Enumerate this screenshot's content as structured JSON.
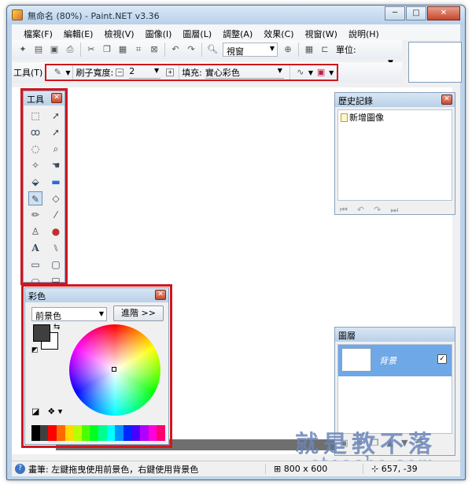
{
  "window": {
    "title": "無命名 (80%) - Paint.NET v3.36",
    "min": "─",
    "max": "□",
    "close": "✕"
  },
  "menu": [
    "檔案(F)",
    "編輯(E)",
    "檢視(V)",
    "圖像(I)",
    "圖層(L)",
    "調整(A)",
    "效果(C)",
    "視窗(W)",
    "說明(H)"
  ],
  "toolbar": {
    "zoom_value": "視窗",
    "units_label": "單位:"
  },
  "toolbar2": {
    "tool_label": "工具(T)",
    "brush_width_label": "刷子寬度:",
    "brush_width_value": "2",
    "fill_label": "填充:",
    "fill_value": "實心彩色"
  },
  "tools_panel": {
    "title": "工具"
  },
  "history_panel": {
    "title": "歷史記錄",
    "items": [
      "新增圖像"
    ]
  },
  "colors_panel": {
    "title": "彩色",
    "dropdown_value": "前景色",
    "more_button": "進階 >>",
    "primary_color": "#3f3f3f",
    "secondary_color": "#ffffff",
    "palette_colors": [
      "#000000",
      "#404040",
      "#ff0000",
      "#ff6a00",
      "#ffd800",
      "#b6ff00",
      "#4cff00",
      "#00ff21",
      "#00ff90",
      "#00ffff",
      "#0094ff",
      "#0026ff",
      "#4800ff",
      "#b200ff",
      "#ff00dc",
      "#ff006e"
    ]
  },
  "layers_panel": {
    "title": "圖層",
    "layers": [
      {
        "name": "背景",
        "visible": "✓"
      }
    ]
  },
  "watermark": {
    "line1": "就是教不落",
    "line2": "steachs.com"
  },
  "status": {
    "help": "畫筆: 左鍵拖曳使用前景色，右鍵使用背景色",
    "image_size": "800 x 600",
    "cursor": "657, -39"
  },
  "accent_color": "#d0161d"
}
